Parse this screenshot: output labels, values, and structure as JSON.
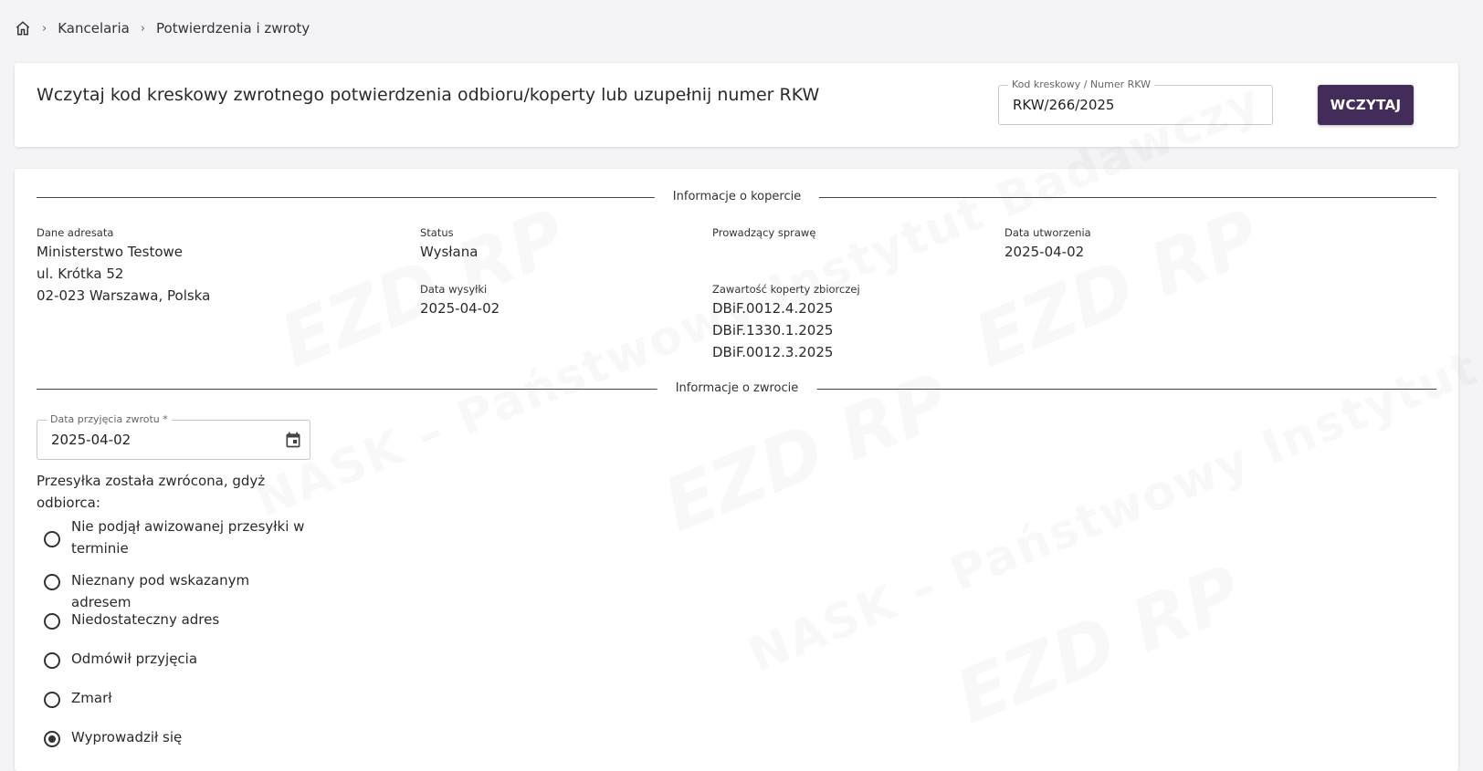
{
  "breadcrumb": {
    "items": [
      "Kancelaria",
      "Potwierdzenia i zwroty"
    ]
  },
  "scan": {
    "title": "Wczytaj kod kreskowy zwrotnego potwierdzenia odbioru/koperty lub uzupełnij numer RKW",
    "field_label": "Kod kreskowy / Numer RKW",
    "field_value": "RKW/266/2025",
    "button_label": "WCZYTAJ"
  },
  "envelope": {
    "section_label": "Informacje o kopercie",
    "addressee_label": "Dane adresata",
    "addressee_lines": [
      "Ministerstwo Testowe",
      "ul. Krótka 52",
      "02-023 Warszawa, Polska"
    ],
    "status_label": "Status",
    "status_value": "Wysłana",
    "handler_label": "Prowadzący sprawę",
    "created_label": "Data utworzenia",
    "created_value": "2025-04-02",
    "sent_label": "Data wysyłki",
    "sent_value": "2025-04-02",
    "contents_label": "Zawartość koperty zbiorczej",
    "contents": [
      "DBiF.0012.4.2025",
      "DBiF.1330.1.2025",
      "DBiF.0012.3.2025"
    ]
  },
  "return": {
    "section_label": "Informacje o zwrocie",
    "date_label": "Data przyjęcia zwrotu *",
    "date_value": "2025-04-02",
    "question": "Przesyłka została zwrócona, gdyż odbiorca:",
    "options": [
      {
        "label": "Nie podjął awizowanej przesyłki w terminie",
        "checked": false
      },
      {
        "label": "Nieznany pod wskazanym adresem",
        "checked": false
      },
      {
        "label": "Niedostateczny adres",
        "checked": false
      },
      {
        "label": "Odmówił przyjęcia",
        "checked": false
      },
      {
        "label": "Zmarł",
        "checked": false
      },
      {
        "label": "Wyprowadził się",
        "checked": true
      }
    ]
  },
  "watermark": {
    "text": "NASK – Państwowy Instytut Badawczy",
    "logo": "EZD RP"
  },
  "colors": {
    "accent": "#432b5a",
    "background": "#f4f4f6"
  }
}
